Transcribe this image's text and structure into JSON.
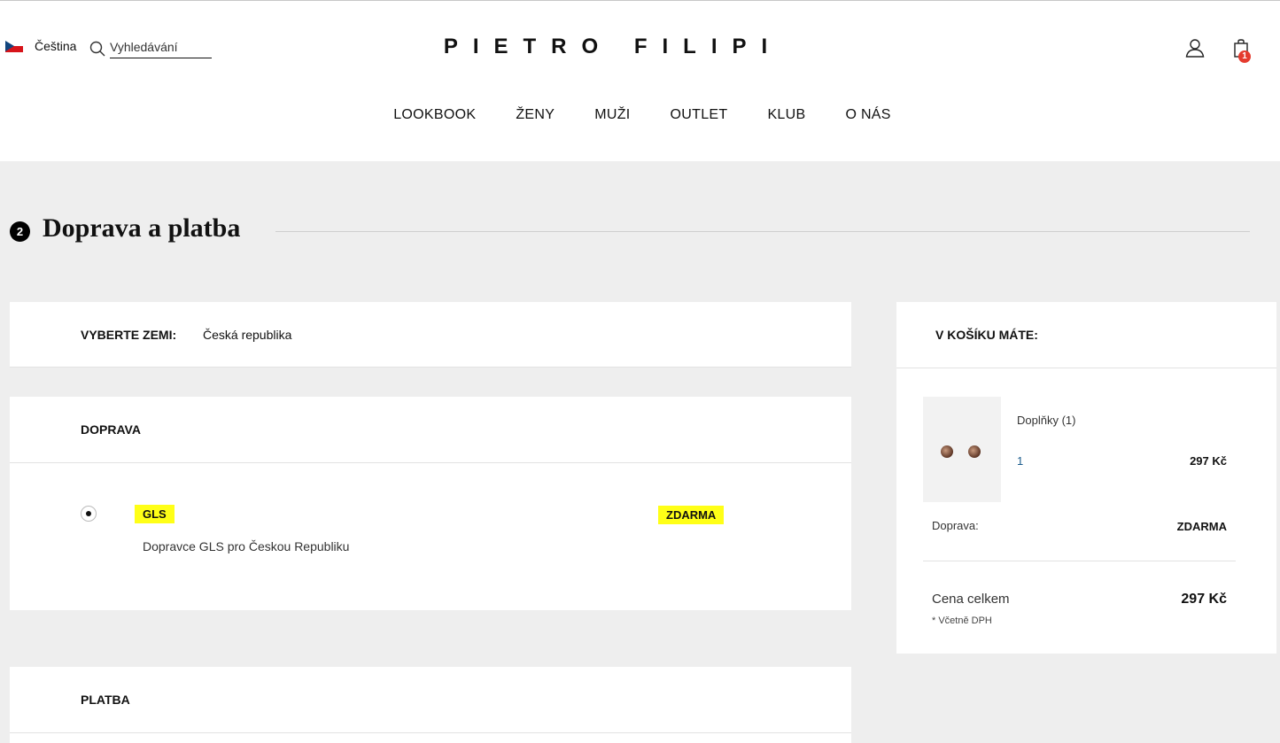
{
  "header": {
    "language": "Čeština",
    "search_placeholder": "Vyhledávání",
    "logo": "PIETRO FILIPI",
    "cart_count": "1"
  },
  "nav": {
    "items": [
      "LOOKBOOK",
      "ŽENY",
      "MUŽI",
      "OUTLET",
      "KLUB",
      "O NÁS"
    ]
  },
  "section": {
    "step": "2",
    "title": "Doprava a platba"
  },
  "country": {
    "label": "VYBERTE ZEMI:",
    "value": "Česká republika"
  },
  "shipping": {
    "title": "DOPRAVA",
    "option_name": "GLS",
    "option_price": "ZDARMA",
    "option_desc": "Dopravce GLS pro Českou Republiku",
    "highlight_color": "#ffff17"
  },
  "payment": {
    "title": "PLATBA"
  },
  "cart": {
    "title": "V KOŠÍKU MÁTE:",
    "item_name": "Doplňky (1)",
    "item_qty": "1",
    "item_price": "297 Kč",
    "shipping_label": "Doprava:",
    "shipping_value": "ZDARMA",
    "total_label": "Cena celkem",
    "total_value": "297 Kč",
    "vat_note": "* Včetně DPH"
  },
  "colors": {
    "badge": "#e53b2e",
    "background": "#eeeeee"
  }
}
